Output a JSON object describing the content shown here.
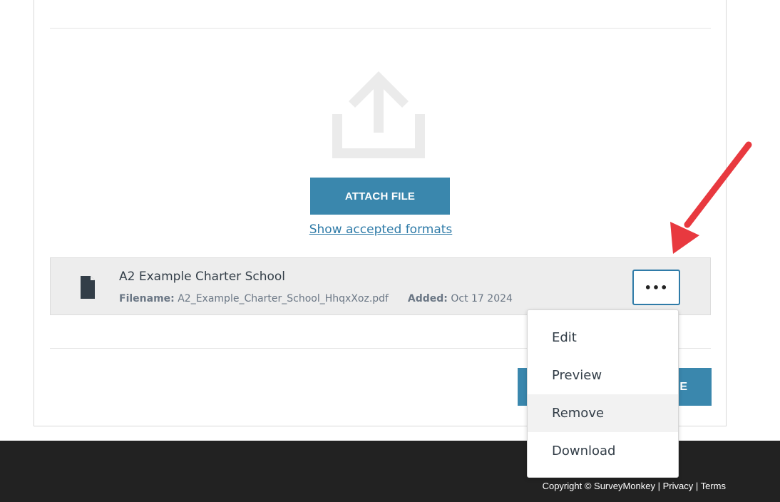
{
  "upload": {
    "attach_label": "ATTACH FILE",
    "formats_link": "Show accepted formats"
  },
  "file": {
    "title": "A2 Example Charter School",
    "filename_label": "Filename:",
    "filename": "A2_Example_Charter_School_HhqxXoz.pdf",
    "added_label": "Added:",
    "added": "Oct 17 2024",
    "more_label": "•••",
    "icon": "document-icon"
  },
  "actions": {
    "save_fragment": "E"
  },
  "menu": {
    "items": [
      {
        "label": "Edit"
      },
      {
        "label": "Preview"
      },
      {
        "label": "Remove"
      },
      {
        "label": "Download"
      }
    ],
    "hovered_index": 2
  },
  "footer": {
    "copyright": "Copyright © SurveyMonkey",
    "sep1": " | ",
    "privacy": "Privacy",
    "sep2": " | ",
    "terms": "Terms"
  },
  "colors": {
    "accent": "#3a87ad",
    "link": "#2f7ba8",
    "annotation_arrow": "#e8393f",
    "footer_bg": "#222222"
  }
}
